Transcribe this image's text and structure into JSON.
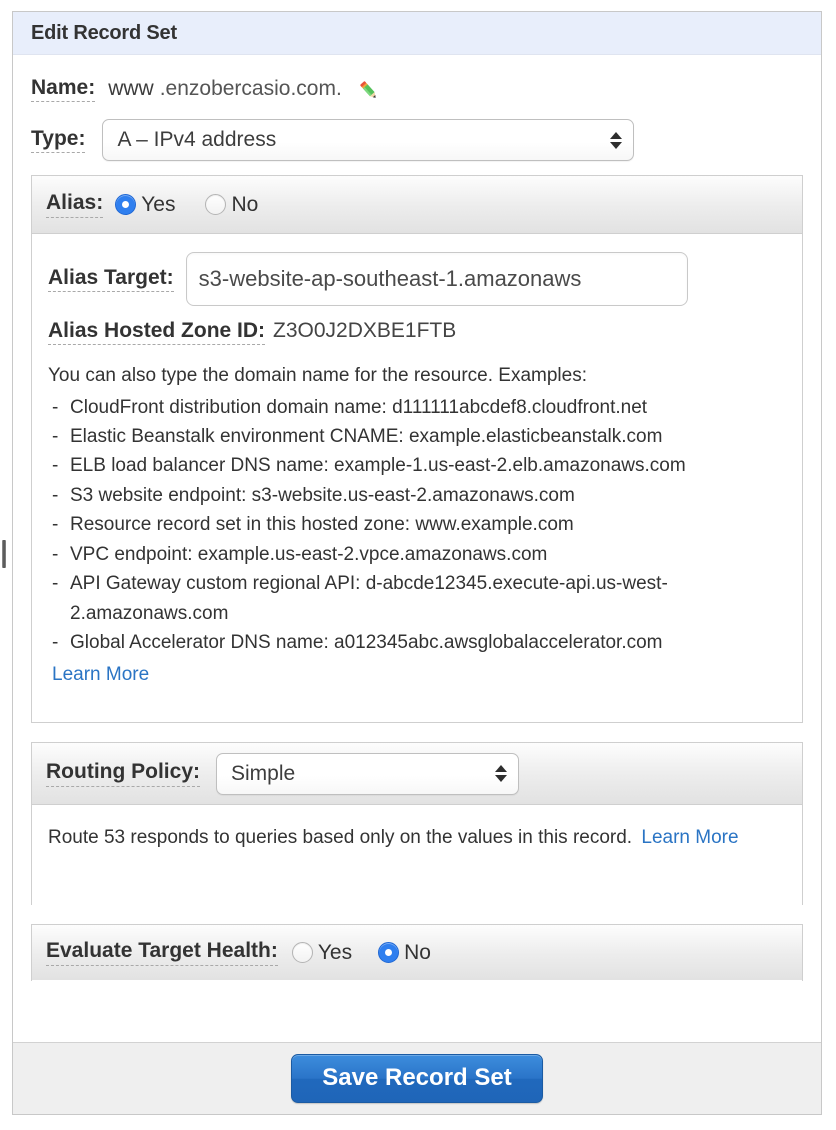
{
  "panel": {
    "title": "Edit Record Set"
  },
  "name_field": {
    "label": "Name:",
    "subdomain": "www",
    "zone_suffix": ".enzobercasio.com.",
    "edit_icon": "pencil-icon"
  },
  "type_field": {
    "label": "Type:",
    "value": "A – IPv4 address"
  },
  "alias": {
    "label": "Alias:",
    "options": [
      "Yes",
      "No"
    ],
    "selected": "Yes",
    "target": {
      "label": "Alias Target:",
      "value": "s3-website-ap-southeast-1.amazonaws"
    },
    "hosted_zone": {
      "label": "Alias Hosted Zone ID:",
      "value": "Z3O0J2DXBE1FTB"
    },
    "help": {
      "lead": "You can also type the domain name for the resource. Examples:",
      "items": [
        "CloudFront distribution domain name: d111111abcdef8.cloudfront.net",
        "Elastic Beanstalk environment CNAME: example.elasticbeanstalk.com",
        "ELB load balancer DNS name: example-1.us-east-2.elb.amazonaws.com",
        "S3 website endpoint: s3-website.us-east-2.amazonaws.com",
        "Resource record set in this hosted zone: www.example.com",
        "VPC endpoint: example.us-east-2.vpce.amazonaws.com",
        "API Gateway custom regional API: d-abcde12345.execute-api.us-west-2.amazonaws.com",
        "Global Accelerator DNS name: a012345abc.awsglobalaccelerator.com"
      ],
      "learn_more": "Learn More"
    }
  },
  "routing_policy": {
    "label": "Routing Policy:",
    "value": "Simple",
    "description": "Route 53 responds to queries based only on the values in this record.",
    "learn_more": "Learn More"
  },
  "evaluate_target_health": {
    "label": "Evaluate Target Health:",
    "options": [
      "Yes",
      "No"
    ],
    "selected": "No"
  },
  "footer": {
    "save_label": "Save Record Set"
  },
  "colors": {
    "title_bar": "#e8eefb",
    "accent_blue": "#2f7fef",
    "link_blue": "#2a74c4",
    "button_blue": "#2a74c8",
    "panel_header_gray": "#ededed"
  }
}
